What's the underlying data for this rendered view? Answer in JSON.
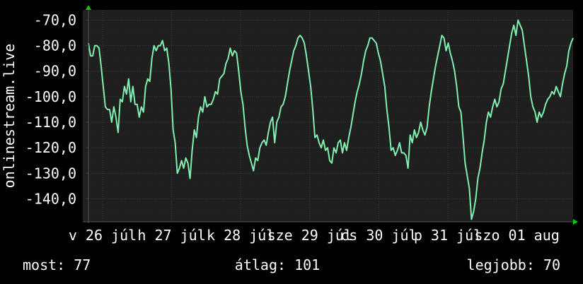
{
  "colors": {
    "background": "#000000",
    "plot_background": "#1f1f1f",
    "grid": "#3a3a3a",
    "minor_grid": "#2f1f1f",
    "line": "#7ff0b0",
    "arrow": "#00cc00",
    "text": "#ffffff"
  },
  "chart_data": {
    "type": "line",
    "ylabel": "onlinestream.live",
    "ylim": [
      -149,
      -66
    ],
    "y_ticks": [
      -140,
      -130,
      -120,
      -110,
      -100,
      -90,
      -80,
      -70
    ],
    "y_tick_labels": [
      "-140,0",
      "-130,0",
      "-120,0",
      "-110,0",
      "-100,0",
      "-90,0",
      "-80,0",
      "-70,0"
    ],
    "xlim": [
      0,
      100
    ],
    "x_tick_labels": [
      "v 26 júl",
      "h 27 júl",
      "k 28 júl",
      "sze 29 júl",
      "cs 30 júl",
      "p 31 júl",
      "szo 01 aug"
    ],
    "grid": true,
    "series": [
      {
        "values": [
          -79,
          -84,
          -84,
          -80,
          -80,
          -81,
          -88,
          -96,
          -104,
          -105,
          -105,
          -110,
          -104,
          -108,
          -114,
          -101,
          -102,
          -96,
          -99,
          -93,
          -102,
          -96,
          -103,
          -103,
          -108,
          -104,
          -106,
          -96,
          -93,
          -94,
          -85,
          -80,
          -82,
          -80,
          -80,
          -78,
          -82,
          -81,
          -87,
          -97,
          -113,
          -118,
          -130,
          -128,
          -125,
          -128,
          -124,
          -126,
          -132,
          -121,
          -113,
          -116,
          -108,
          -104,
          -106,
          -100,
          -104,
          -103,
          -103,
          -101,
          -98,
          -99,
          -93,
          -92,
          -91,
          -87,
          -85,
          -81,
          -84,
          -82,
          -83,
          -90,
          -98,
          -103,
          -112,
          -119,
          -123,
          -126,
          -129,
          -124,
          -125,
          -120,
          -118,
          -117,
          -119,
          -114,
          -110,
          -108,
          -118,
          -110,
          -108,
          -104,
          -103,
          -100,
          -95,
          -90,
          -86,
          -82,
          -80,
          -77,
          -76,
          -77,
          -79,
          -84,
          -90,
          -96,
          -105,
          -116,
          -115,
          -118,
          -120,
          -117,
          -121,
          -120,
          -125,
          -126,
          -120,
          -122,
          -118,
          -117,
          -122,
          -118,
          -121,
          -116,
          -112,
          -107,
          -102,
          -98,
          -95,
          -91,
          -86,
          -82,
          -80,
          -77,
          -77,
          -78,
          -79,
          -83,
          -86,
          -91,
          -96,
          -105,
          -112,
          -121,
          -120,
          -123,
          -121,
          -118,
          -122,
          -122,
          -123,
          -128,
          -115,
          -118,
          -113,
          -116,
          -114,
          -110,
          -113,
          -115,
          -112,
          -104,
          -98,
          -93,
          -88,
          -84,
          -80,
          -76,
          -77,
          -82,
          -79,
          -83,
          -86,
          -90,
          -96,
          -104,
          -106,
          -116,
          -126,
          -131,
          -136,
          -148,
          -145,
          -140,
          -132,
          -128,
          -122,
          -117,
          -110,
          -106,
          -108,
          -104,
          -101,
          -104,
          -102,
          -97,
          -95,
          -90,
          -85,
          -80,
          -75,
          -72,
          -76,
          -70,
          -72,
          -74,
          -80,
          -86,
          -92,
          -100,
          -104,
          -106,
          -110,
          -106,
          -108,
          -106,
          -103,
          -101,
          -100,
          -98,
          -99,
          -96,
          -98,
          -100,
          -95,
          -91,
          -88,
          -82,
          -79,
          -77
        ]
      }
    ]
  },
  "stats": {
    "current": "most: 77",
    "average": "átlag: 101",
    "best": "legjobb: 70"
  }
}
